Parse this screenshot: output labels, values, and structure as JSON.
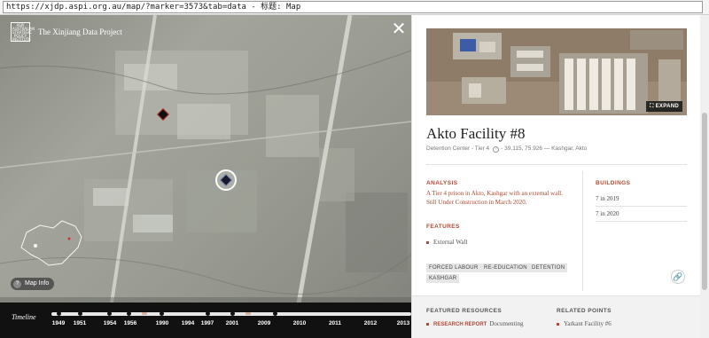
{
  "browser": {
    "url": "https://xjdp.aspi.org.au/map/?marker=3573&tab=data - 标题: Map"
  },
  "map": {
    "logo_text": "ASPI AUSTRALIAN STRATEGIC POLICY INSTITUTE",
    "project_title": "The Xinjiang Data Project",
    "close_symbol": "✕",
    "map_info_label": "Map Info",
    "map_info_q": "?"
  },
  "timeline": {
    "label": "Timeline",
    "years": [
      "1949",
      "1951",
      "1954",
      "1956",
      "1990",
      "1994",
      "1997",
      "2001",
      "2009",
      "2010",
      "2011",
      "2012",
      "2013"
    ]
  },
  "panel": {
    "expand_label": "EXPAND",
    "title": "Akto Facility #8",
    "subtitle_type": "Detention Center - Tier 4",
    "subtitle_q": "?",
    "subtitle_loc": "- 39.115, 75.926 — Kashgar, Akto",
    "analysis_heading": "ANALYSIS",
    "analysis_text": "A Tier 4 prison in Akto, Kashgar with an external wall. Still Under Construction in March 2020.",
    "buildings_heading": "BUILDINGS",
    "buildings": [
      "7 in 2019",
      "7 in 2020"
    ],
    "features_heading": "FEATURES",
    "features": [
      "External Wall"
    ],
    "tags": [
      "FORCED LABOUR",
      "RE-EDUCATION",
      "DETENTION",
      "KASHGAR"
    ],
    "link_icon": "🔗",
    "featured_heading": "FEATURED RESOURCES",
    "featured_label": "RESEARCH REPORT",
    "featured_text": "Documenting",
    "related_heading": "RELATED POINTS",
    "related_point": "Yarkant Facility #6"
  },
  "colors": {
    "accent": "#b24a35",
    "timeline_bg": "#111111"
  }
}
